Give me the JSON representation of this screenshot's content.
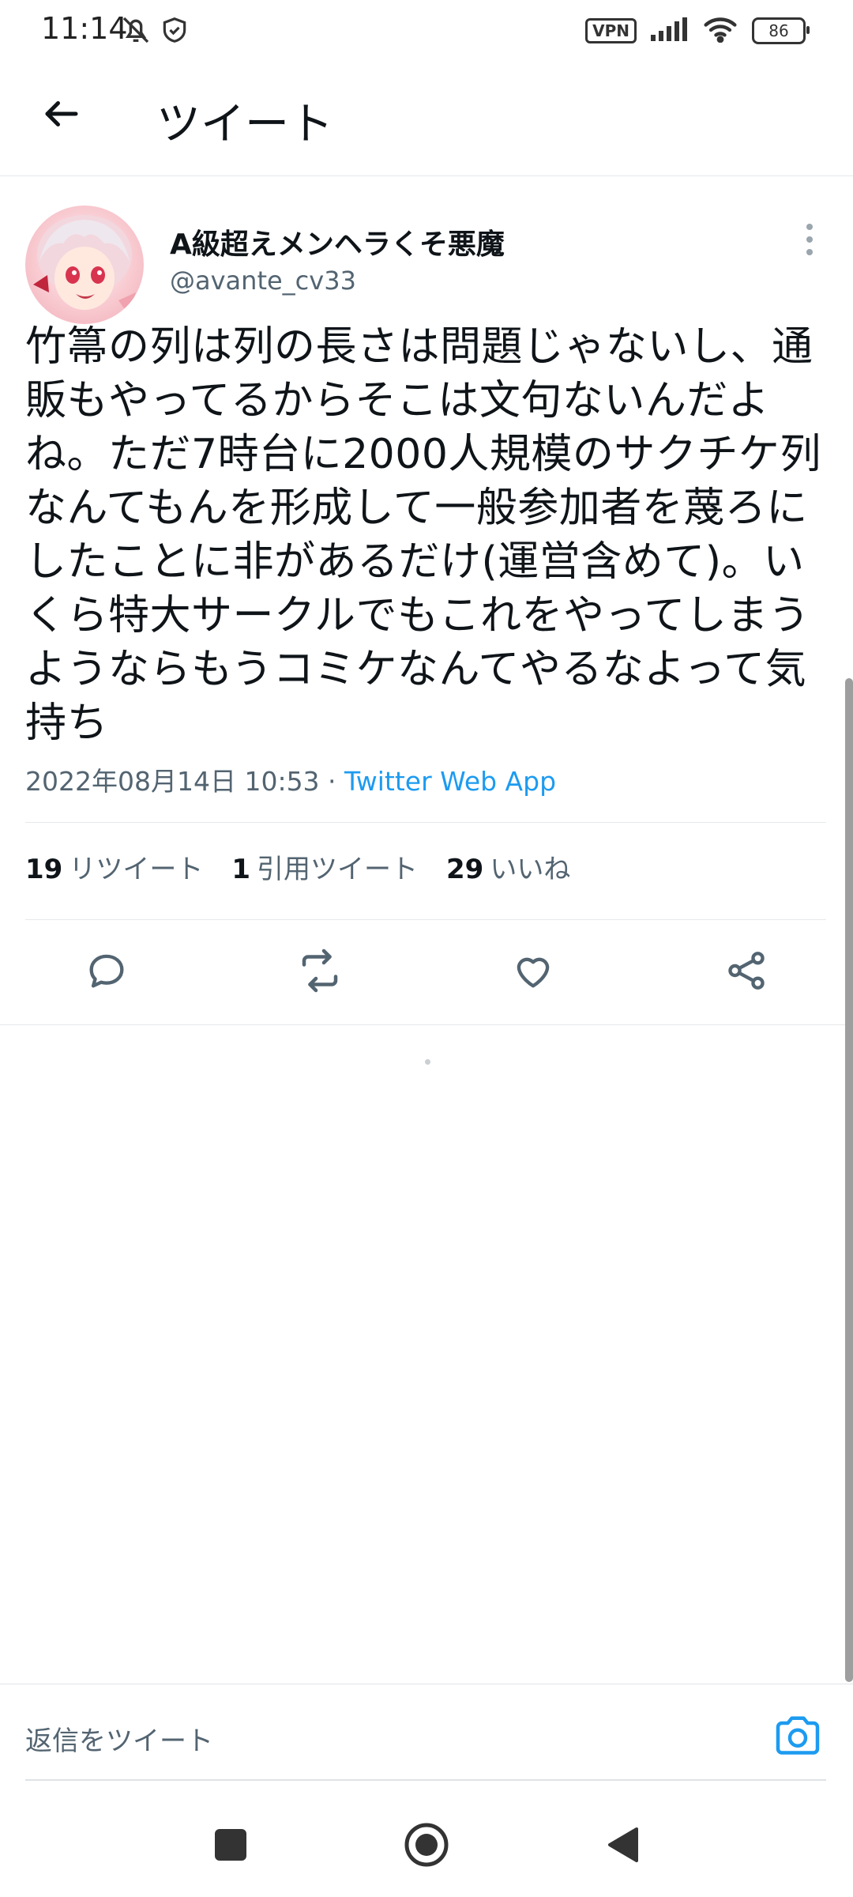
{
  "status_bar": {
    "time": "11:14",
    "vpn": "VPN",
    "battery": "86"
  },
  "header": {
    "title": "ツイート"
  },
  "tweet": {
    "display_name": "A級超えメンヘラくそ悪魔",
    "handle": "@avante_cv33",
    "text": "竹箒の列は列の長さは問題じゃないし、通販もやってるからそこは文句ないんだよね。ただ7時台に2000人規模のサクチケ列なんてもんを形成して一般参加者を蔑ろにしたことに非があるだけ(運営含めて)。いくら特大サークルでもこれをやってしまうようならもうコミケなんてやるなよって気持ち",
    "date": "2022年08月14日 10:53 · ",
    "source": "Twitter Web App"
  },
  "stats": {
    "retweets_count": "19",
    "retweets_label": "リツイート",
    "quotes_count": "1",
    "quotes_label": "引用ツイート",
    "likes_count": "29",
    "likes_label": "いいね"
  },
  "reply": {
    "placeholder": "返信をツイート"
  },
  "icons": {
    "back": "arrow-left-icon",
    "more": "more-vertical-icon",
    "reply": "reply-icon",
    "retweet": "retweet-icon",
    "like": "heart-icon",
    "share": "share-icon",
    "camera": "camera-icon"
  },
  "colors": {
    "accent": "#1d9bf0",
    "text": "#0f1419",
    "secondary": "#536471"
  }
}
